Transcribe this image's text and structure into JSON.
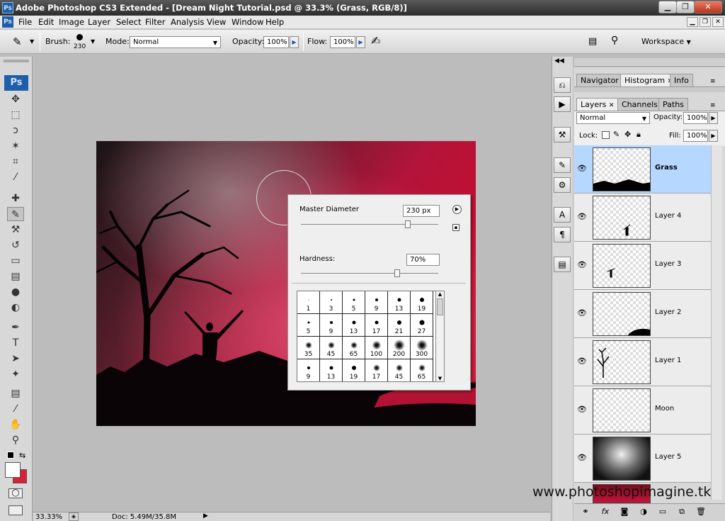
{
  "window": {
    "title": "Adobe Photoshop CS3 Extended - [Dream Night Tutorial.psd @ 33.3% (Grass, RGB/8)]",
    "app_icon": "Ps",
    "controls": [
      "minimize-icon",
      "restore-icon",
      "close-icon"
    ]
  },
  "menubar": {
    "items": [
      "File",
      "Edit",
      "Image",
      "Layer",
      "Select",
      "Filter",
      "Analysis",
      "View",
      "Window",
      "Help"
    ]
  },
  "options": {
    "brush_label": "Brush:",
    "brush_size": "230",
    "mode_label": "Mode:",
    "mode_value": "Normal",
    "opacity_label": "Opacity:",
    "opacity_value": "100%",
    "flow_label": "Flow:",
    "flow_value": "100%",
    "workspace_label": "Workspace"
  },
  "toolbox": {
    "logo": "Ps",
    "tools": [
      {
        "name": "move-tool-icon",
        "glyph": "✥"
      },
      {
        "name": "marquee-tool-icon",
        "glyph": "⬚"
      },
      {
        "name": "lasso-tool-icon",
        "glyph": "ↄ"
      },
      {
        "name": "magic-wand-tool-icon",
        "glyph": "✶"
      },
      {
        "name": "crop-tool-icon",
        "glyph": "⌗"
      },
      {
        "name": "eyedropper-tool-icon",
        "glyph": "⁄"
      },
      {
        "name": "healing-brush-tool-icon",
        "glyph": "✚"
      },
      {
        "name": "brush-tool-icon",
        "glyph": "✎"
      },
      {
        "name": "clone-stamp-tool-icon",
        "glyph": "⚒"
      },
      {
        "name": "history-brush-tool-icon",
        "glyph": "↺"
      },
      {
        "name": "eraser-tool-icon",
        "glyph": "▭"
      },
      {
        "name": "gradient-tool-icon",
        "glyph": "▤"
      },
      {
        "name": "blur-tool-icon",
        "glyph": "●"
      },
      {
        "name": "dodge-tool-icon",
        "glyph": "◐"
      },
      {
        "name": "pen-tool-icon",
        "glyph": "✒"
      },
      {
        "name": "type-tool-icon",
        "glyph": "T"
      },
      {
        "name": "path-selection-tool-icon",
        "glyph": "➤"
      },
      {
        "name": "custom-shape-tool-icon",
        "glyph": "✦"
      },
      {
        "name": "notes-tool-icon",
        "glyph": "▤"
      },
      {
        "name": "color-sampler-tool-icon",
        "glyph": "⁄"
      },
      {
        "name": "hand-tool-icon",
        "glyph": "✋"
      },
      {
        "name": "zoom-tool-icon",
        "glyph": "⚲"
      }
    ],
    "foreground_color": "#ffffff",
    "background_color": "#d8203a"
  },
  "brush_picker": {
    "master_diameter_label": "Master Diameter",
    "master_diameter_value": "230 px",
    "master_diameter_fraction": 0.78,
    "hardness_label": "Hardness:",
    "hardness_value": "70%",
    "hardness_fraction": 0.7,
    "presets": [
      [
        "1",
        "3",
        "5",
        "9",
        "13",
        "19"
      ],
      [
        "5",
        "9",
        "13",
        "17",
        "21",
        "27"
      ],
      [
        "35",
        "45",
        "65",
        "100",
        "200",
        "300"
      ],
      [
        "9",
        "13",
        "19",
        "17",
        "45",
        "65"
      ]
    ]
  },
  "status": {
    "zoom": "33.33%",
    "doc": "Doc: 5.49M/35.8M"
  },
  "panels": {
    "top_tabs": [
      "Navigator",
      "Histogram",
      "Info"
    ],
    "layer_tabs": [
      "Layers",
      "Channels",
      "Paths"
    ],
    "blend_mode": "Normal",
    "opacity_label": "Opacity:",
    "opacity_value": "100%",
    "lock_label": "Lock:",
    "fill_label": "Fill:",
    "fill_value": "100%",
    "layers": [
      "Grass",
      "Layer 4",
      "Layer 3",
      "Layer 2",
      "Layer 1",
      "Moon",
      "Layer 5"
    ],
    "selected_layer": "Grass"
  },
  "watermark": "www.photoshopimagine.tk",
  "colors": {
    "accent_selected": "#b6d7ff",
    "canvas_red": "#c4143a"
  }
}
